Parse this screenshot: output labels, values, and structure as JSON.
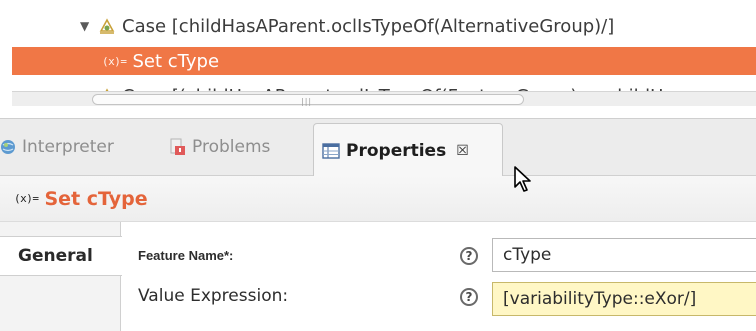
{
  "tree": {
    "rows": [
      {
        "label": "Case [childHasAParent.oclIsTypeOf(AlternativeGroup)/]",
        "arrow": "▼"
      },
      {
        "label": "Set cType",
        "fx": "(x)=",
        "selected": true
      },
      {
        "label": "Case [(childHasAParent.oclIsTypeOf(FeatureGroup) or childHa",
        "arrow": "▼"
      }
    ],
    "scroll_grip": "|||"
  },
  "tabs": [
    {
      "label": "Interpreter",
      "icon": "globe-icon"
    },
    {
      "label": "Problems",
      "icon": "problems-icon"
    },
    {
      "label": "Properties",
      "icon": "properties-icon",
      "active": true,
      "close": "☒"
    }
  ],
  "properties": {
    "fx": "(x)=",
    "title": "Set cType",
    "section_tab": "General",
    "feature_label": "Feature Name*:",
    "feature_value": "cType",
    "value_label": "Value Expression:",
    "value_value": "[variabilityType::eXor/]",
    "help": "?"
  },
  "colors": {
    "selection": "#f07746",
    "title": "#e4643a",
    "value_field": "#fff7c5"
  }
}
